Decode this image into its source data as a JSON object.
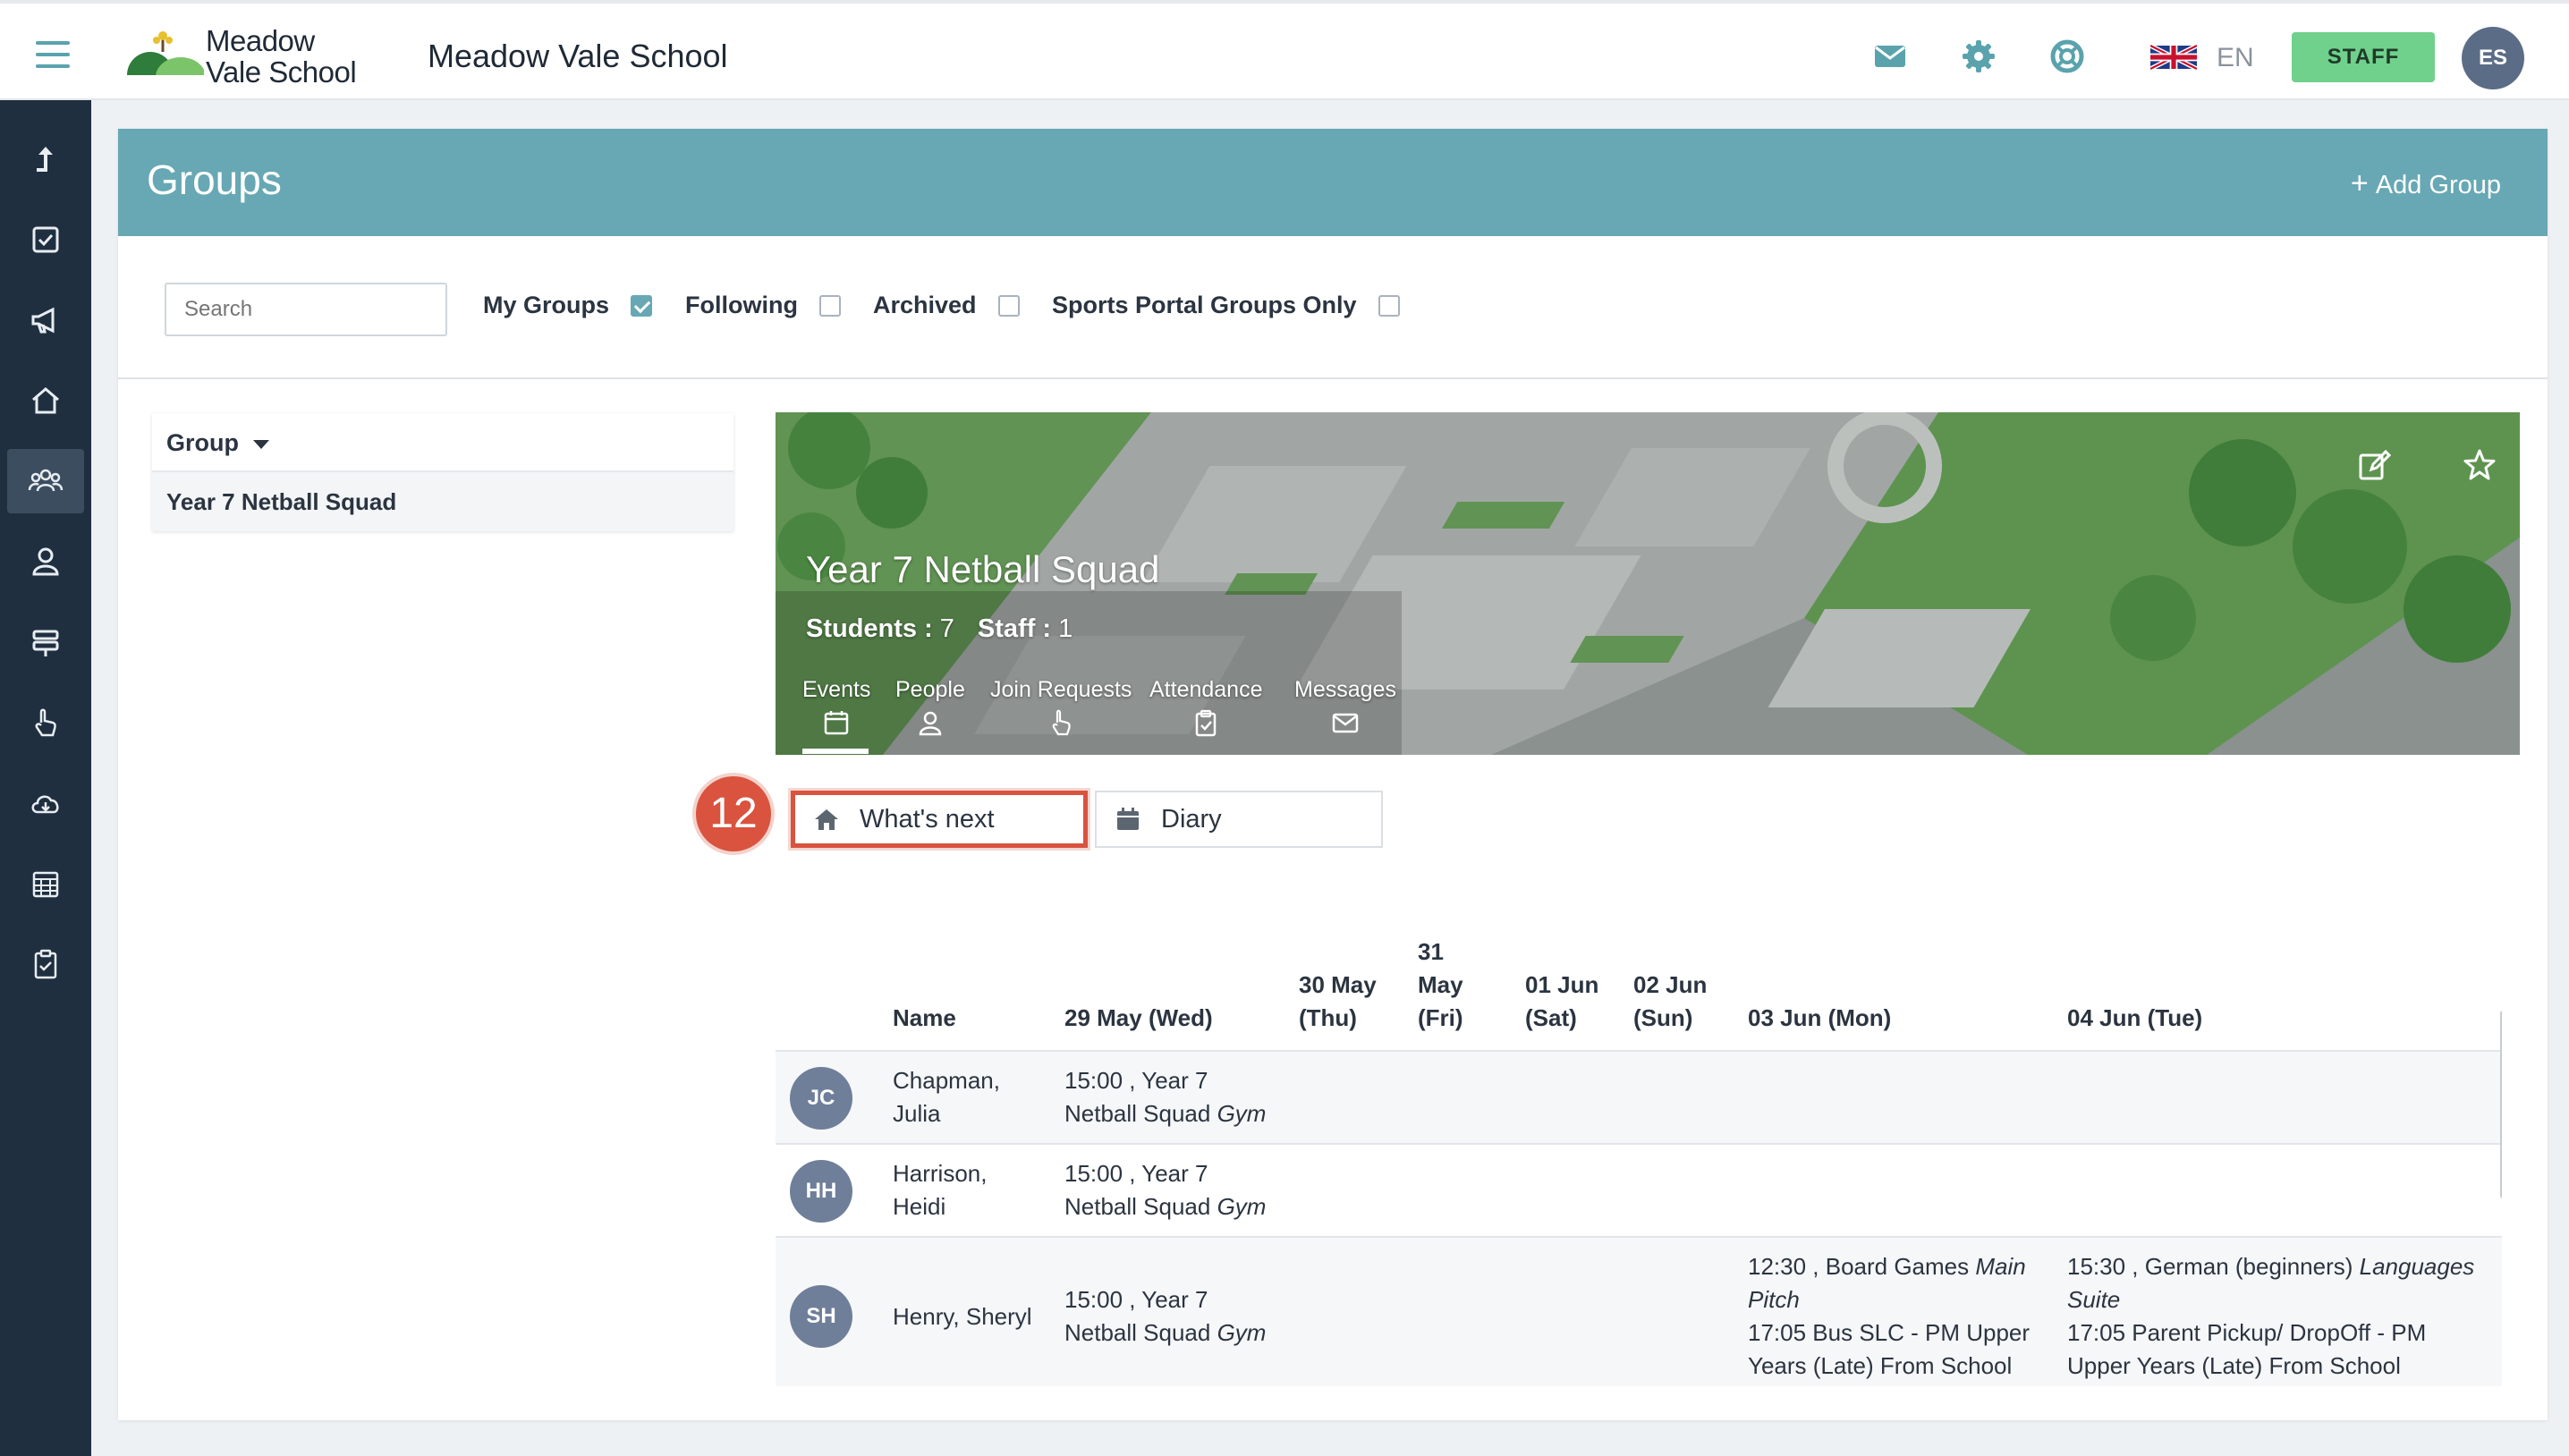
{
  "app": {
    "logo_line1": "Meadow",
    "logo_line2": "Vale School",
    "school_name": "Meadow Vale School",
    "language": "EN",
    "staff_label": "STAFF",
    "user_initials": "ES"
  },
  "page": {
    "title": "Groups",
    "add_group_label": "Add Group"
  },
  "filters": {
    "search_placeholder": "Search",
    "my_groups_label": "My Groups",
    "my_groups_checked": true,
    "following_label": "Following",
    "following_checked": false,
    "archived_label": "Archived",
    "archived_checked": false,
    "sports_label": "Sports Portal Groups Only",
    "sports_checked": false
  },
  "group_list": {
    "header": "Group",
    "items": [
      "Year 7 Netball Squad"
    ]
  },
  "banner": {
    "title": "Year 7 Netball Squad",
    "students_label": "Students :",
    "students_count": "7",
    "staff_label": "Staff :",
    "staff_count": "1",
    "tabs": [
      "Events",
      "People",
      "Join Requests",
      "Attendance",
      "Messages"
    ]
  },
  "callout_number": "12",
  "subtabs": {
    "whats_next": "What's next",
    "diary": "Diary"
  },
  "table": {
    "headers": {
      "name": "Name",
      "d1": "29 May (Wed)",
      "d2a": "30 May",
      "d2b": "(Thu)",
      "d3a": "31",
      "d3b": "May",
      "d3c": "(Fri)",
      "d4a": "01 Jun",
      "d4b": "(Sat)",
      "d5a": "02 Jun",
      "d5b": "(Sun)",
      "d6": "03 Jun (Mon)",
      "d7": "04 Jun (Tue)"
    },
    "rows": [
      {
        "initials": "JC",
        "name1": "Chapman,",
        "name2": "Julia",
        "wed1": "15:00 , Year 7",
        "wed2": "Netball Squad",
        "wed_loc": "Gym"
      },
      {
        "initials": "HH",
        "name1": "Harrison,",
        "name2": "Heidi",
        "wed1": "15:00 , Year 7",
        "wed2": "Netball Squad",
        "wed_loc": "Gym"
      },
      {
        "initials": "SH",
        "name1": "Henry, Sheryl",
        "wed1": "15:00 , Year 7",
        "wed2": "Netball Squad",
        "wed_loc": "Gym",
        "mon1": "12:30 , Board Games",
        "mon1_loc_a": "Main",
        "mon1_loc_b": "Pitch",
        "mon2": "17:05 Bus SLC - PM Upper",
        "mon3": "Years (Late) From School",
        "tue1": "15:30 , German (beginners)",
        "tue1_loc_a": "Languages",
        "tue1_loc_b": "Suite",
        "tue2": "17:05 Parent Pickup/ DropOff - PM",
        "tue3": "Upper Years (Late) From School"
      }
    ]
  },
  "colors": {
    "header_teal": "#67a8b4",
    "sidebar": "#1f2f40",
    "staff_green": "#6fd18b",
    "callout_red": "#d9533f"
  }
}
